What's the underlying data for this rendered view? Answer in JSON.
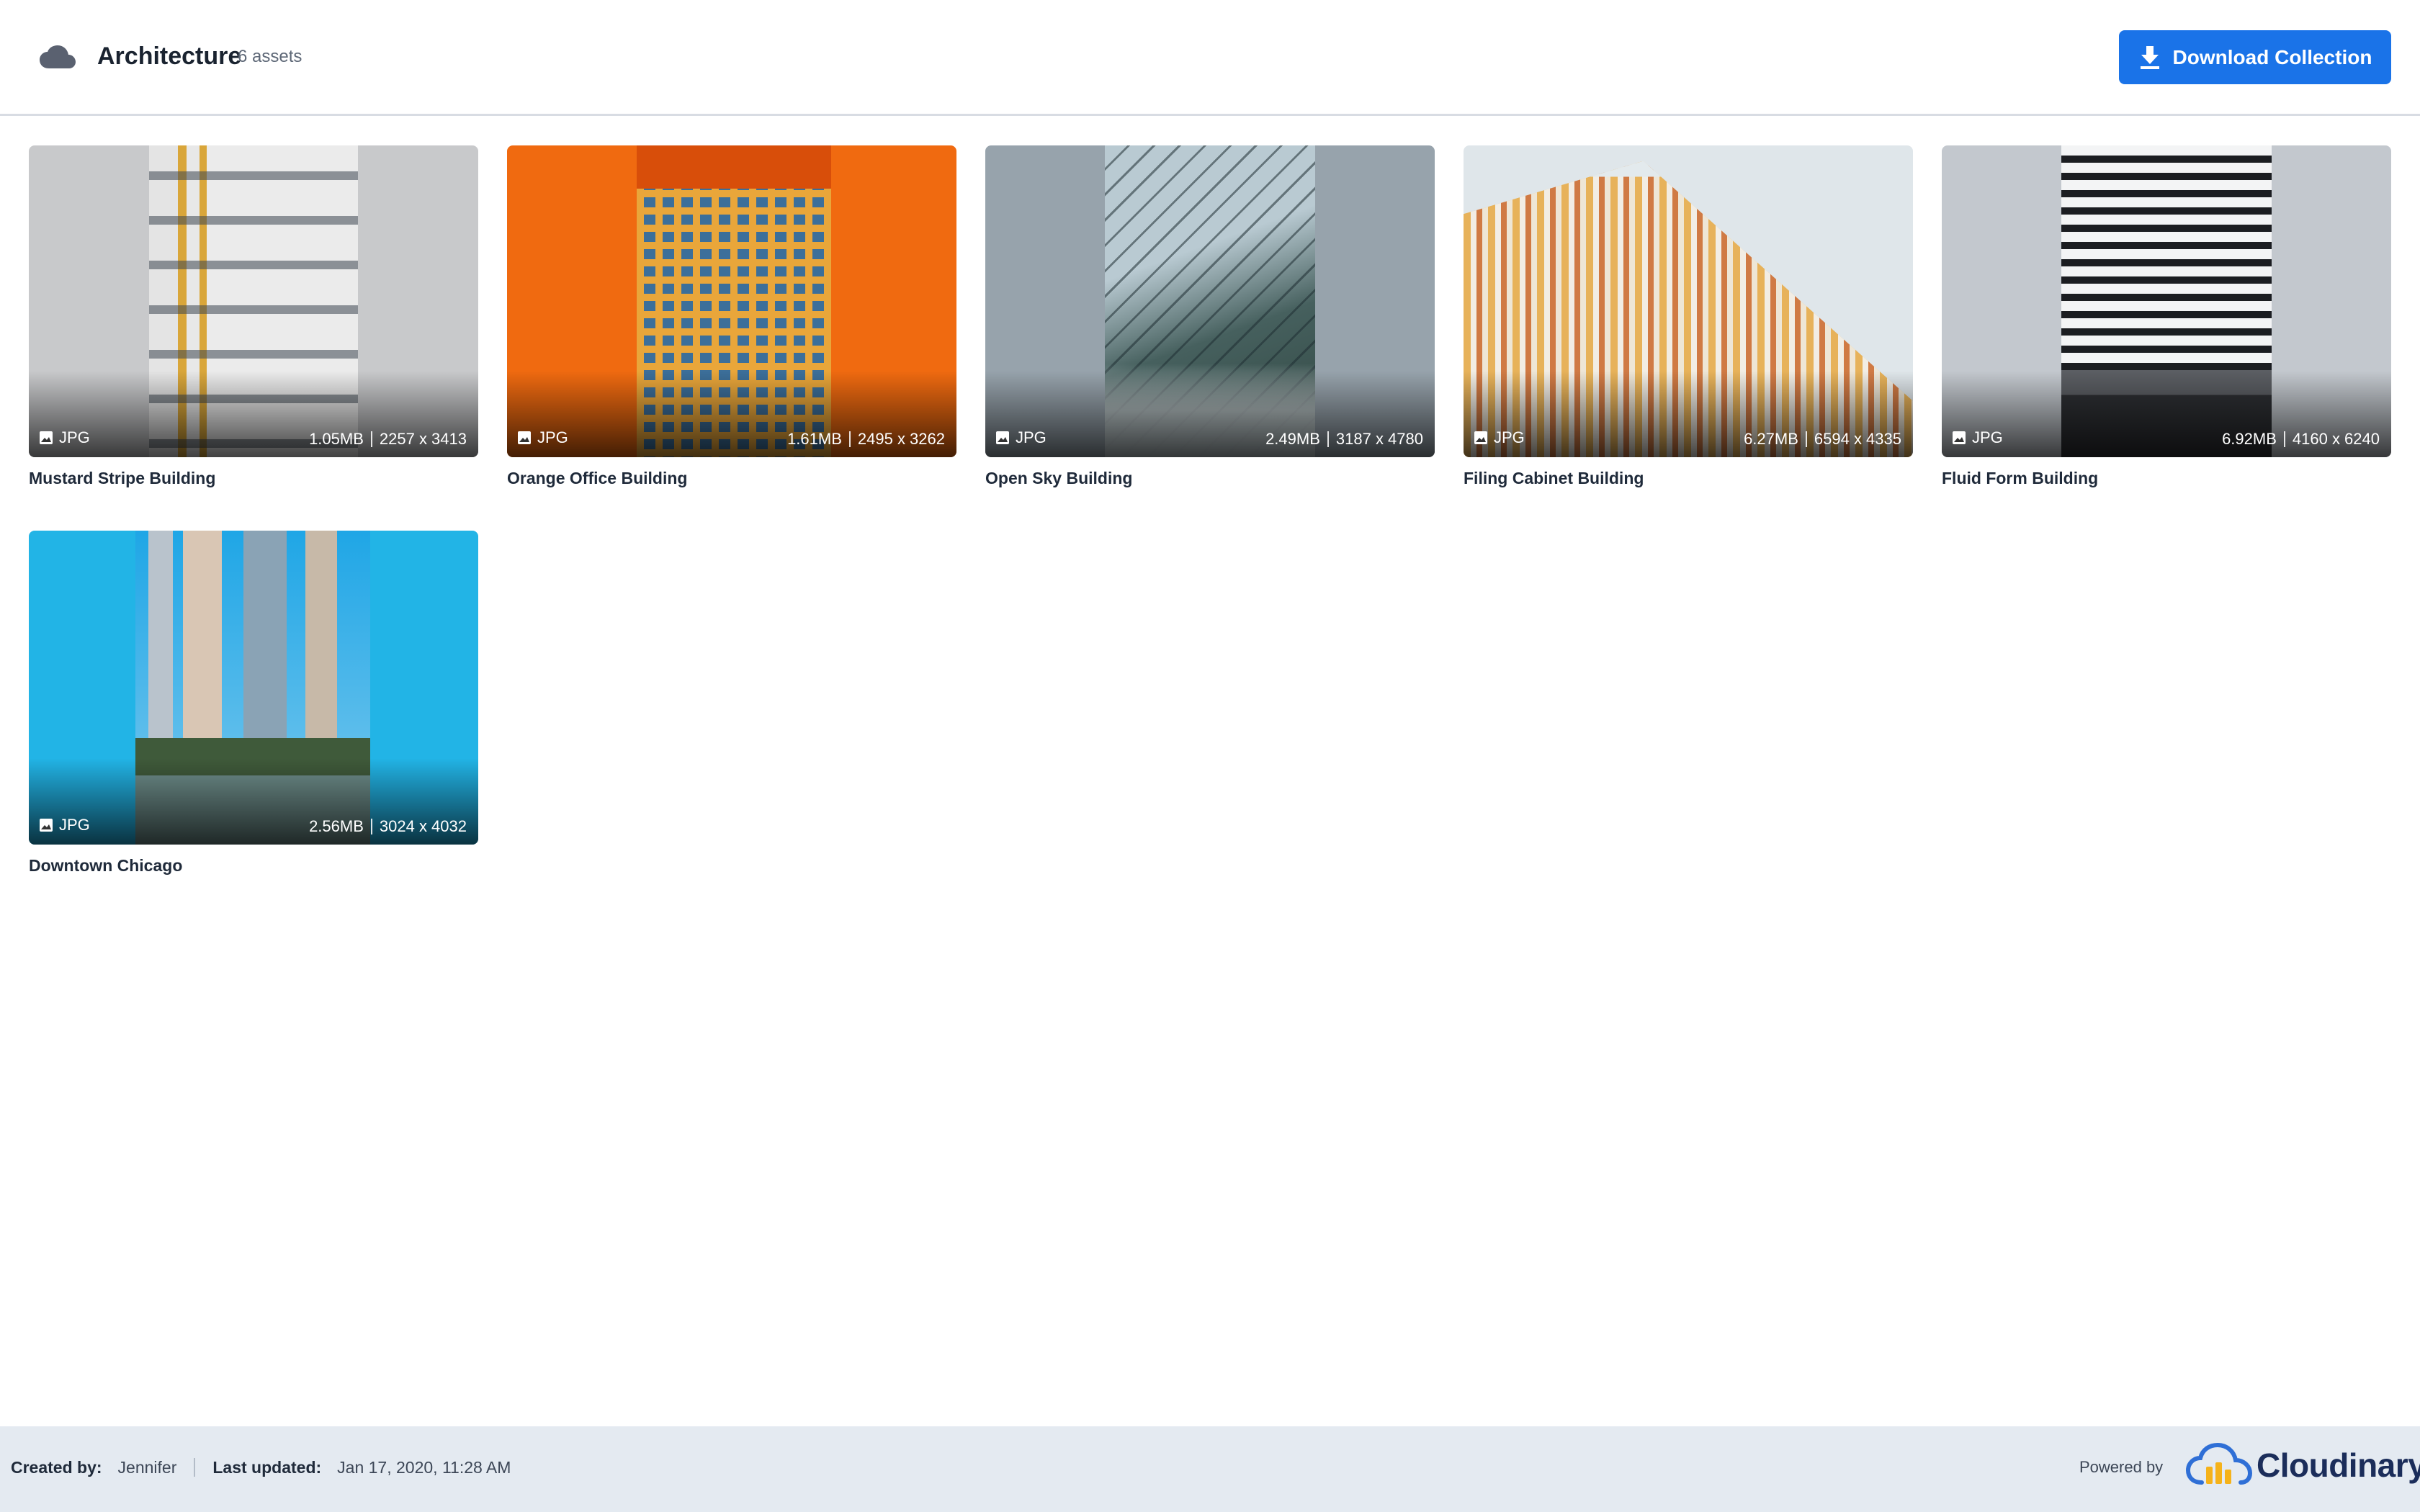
{
  "header": {
    "title": "Architecture",
    "asset_count": "6 assets",
    "download_label": "Download Collection",
    "accent_color": "#1a73e8"
  },
  "assets": [
    {
      "name": "Mustard Stripe Building",
      "format": "JPG",
      "size": "1.05MB",
      "dimensions": "2257 x 3413"
    },
    {
      "name": "Orange Office Building",
      "format": "JPG",
      "size": "1.61MB",
      "dimensions": "2495 x 3262"
    },
    {
      "name": "Open Sky Building",
      "format": "JPG",
      "size": "2.49MB",
      "dimensions": "3187 x 4780"
    },
    {
      "name": "Filing Cabinet Building",
      "format": "JPG",
      "size": "6.27MB",
      "dimensions": "6594 x 4335"
    },
    {
      "name": "Fluid Form Building",
      "format": "JPG",
      "size": "6.92MB",
      "dimensions": "4160 x 6240"
    },
    {
      "name": "Downtown Chicago",
      "format": "JPG",
      "size": "2.56MB",
      "dimensions": "3024 x 4032"
    }
  ],
  "footer": {
    "created_by_label": "Created by:",
    "created_by": "Jennifer",
    "last_updated_label": "Last updated:",
    "last_updated": "Jan 17, 2020, 11:28 AM",
    "powered_by": "Powered by",
    "brand": "Cloudinary"
  }
}
